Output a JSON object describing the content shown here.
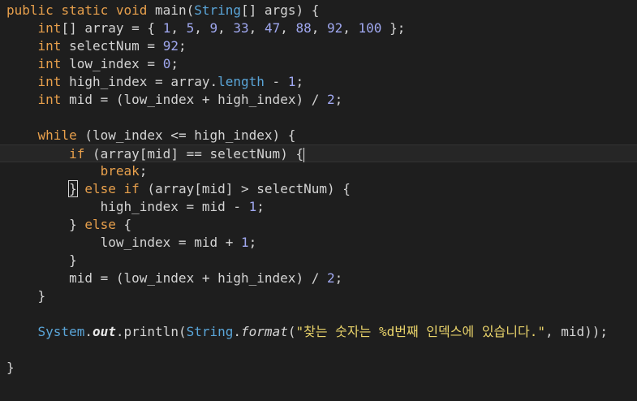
{
  "lines": [
    {
      "indent": "",
      "tokens": [
        {
          "t": "kw",
          "v": "public"
        },
        {
          "t": "p",
          "v": " "
        },
        {
          "t": "kw",
          "v": "static"
        },
        {
          "t": "p",
          "v": " "
        },
        {
          "t": "kw",
          "v": "void"
        },
        {
          "t": "p",
          "v": " "
        },
        {
          "t": "fn",
          "v": "main"
        },
        {
          "t": "p",
          "v": "("
        },
        {
          "t": "typ",
          "v": "String"
        },
        {
          "t": "p",
          "v": "[] "
        },
        {
          "t": "id",
          "v": "args"
        },
        {
          "t": "p",
          "v": ") {"
        }
      ]
    },
    {
      "indent": "    ",
      "tokens": [
        {
          "t": "type",
          "v": "int"
        },
        {
          "t": "p",
          "v": "[] "
        },
        {
          "t": "id",
          "v": "array"
        },
        {
          "t": "p",
          "v": " = { "
        },
        {
          "t": "num",
          "v": "1"
        },
        {
          "t": "p",
          "v": ", "
        },
        {
          "t": "num",
          "v": "5"
        },
        {
          "t": "p",
          "v": ", "
        },
        {
          "t": "num",
          "v": "9"
        },
        {
          "t": "p",
          "v": ", "
        },
        {
          "t": "num",
          "v": "33"
        },
        {
          "t": "p",
          "v": ", "
        },
        {
          "t": "num",
          "v": "47"
        },
        {
          "t": "p",
          "v": ", "
        },
        {
          "t": "num",
          "v": "88"
        },
        {
          "t": "p",
          "v": ", "
        },
        {
          "t": "num",
          "v": "92"
        },
        {
          "t": "p",
          "v": ", "
        },
        {
          "t": "num",
          "v": "100"
        },
        {
          "t": "p",
          "v": " };"
        }
      ]
    },
    {
      "indent": "    ",
      "tokens": [
        {
          "t": "type",
          "v": "int"
        },
        {
          "t": "p",
          "v": " "
        },
        {
          "t": "id",
          "v": "selectNum"
        },
        {
          "t": "p",
          "v": " = "
        },
        {
          "t": "num",
          "v": "92"
        },
        {
          "t": "p",
          "v": ";"
        }
      ]
    },
    {
      "indent": "    ",
      "tokens": [
        {
          "t": "type",
          "v": "int"
        },
        {
          "t": "p",
          "v": " "
        },
        {
          "t": "id",
          "v": "low_index"
        },
        {
          "t": "p",
          "v": " = "
        },
        {
          "t": "num",
          "v": "0"
        },
        {
          "t": "p",
          "v": ";"
        }
      ]
    },
    {
      "indent": "    ",
      "tokens": [
        {
          "t": "type",
          "v": "int"
        },
        {
          "t": "p",
          "v": " "
        },
        {
          "t": "id",
          "v": "high_index"
        },
        {
          "t": "p",
          "v": " = "
        },
        {
          "t": "id",
          "v": "array"
        },
        {
          "t": "p",
          "v": "."
        },
        {
          "t": "prop",
          "v": "length"
        },
        {
          "t": "p",
          "v": " - "
        },
        {
          "t": "num",
          "v": "1"
        },
        {
          "t": "p",
          "v": ";"
        }
      ]
    },
    {
      "indent": "    ",
      "tokens": [
        {
          "t": "type",
          "v": "int"
        },
        {
          "t": "p",
          "v": " "
        },
        {
          "t": "id",
          "v": "mid"
        },
        {
          "t": "p",
          "v": " = ("
        },
        {
          "t": "id",
          "v": "low_index"
        },
        {
          "t": "p",
          "v": " + "
        },
        {
          "t": "id",
          "v": "high_index"
        },
        {
          "t": "p",
          "v": ") / "
        },
        {
          "t": "num",
          "v": "2"
        },
        {
          "t": "p",
          "v": ";"
        }
      ]
    },
    {
      "indent": "",
      "tokens": []
    },
    {
      "indent": "    ",
      "tokens": [
        {
          "t": "kw",
          "v": "while"
        },
        {
          "t": "p",
          "v": " ("
        },
        {
          "t": "id",
          "v": "low_index"
        },
        {
          "t": "p",
          "v": " <= "
        },
        {
          "t": "id",
          "v": "high_index"
        },
        {
          "t": "p",
          "v": ") {"
        }
      ]
    },
    {
      "indent": "        ",
      "current": true,
      "tokens": [
        {
          "t": "kw",
          "v": "if"
        },
        {
          "t": "p",
          "v": " ("
        },
        {
          "t": "id",
          "v": "array"
        },
        {
          "t": "p",
          "v": "["
        },
        {
          "t": "id",
          "v": "mid"
        },
        {
          "t": "p",
          "v": "] == "
        },
        {
          "t": "id",
          "v": "selectNum"
        },
        {
          "t": "p",
          "v": ") {"
        },
        {
          "t": "caret",
          "v": ""
        }
      ]
    },
    {
      "indent": "            ",
      "tokens": [
        {
          "t": "kw",
          "v": "break"
        },
        {
          "t": "p",
          "v": ";"
        }
      ]
    },
    {
      "indent": "        ",
      "tokens": [
        {
          "t": "box",
          "v": "}"
        },
        {
          "t": "p",
          "v": " "
        },
        {
          "t": "kw",
          "v": "else"
        },
        {
          "t": "p",
          "v": " "
        },
        {
          "t": "kw",
          "v": "if"
        },
        {
          "t": "p",
          "v": " ("
        },
        {
          "t": "id",
          "v": "array"
        },
        {
          "t": "p",
          "v": "["
        },
        {
          "t": "id",
          "v": "mid"
        },
        {
          "t": "p",
          "v": "] > "
        },
        {
          "t": "id",
          "v": "selectNum"
        },
        {
          "t": "p",
          "v": ") {"
        }
      ]
    },
    {
      "indent": "            ",
      "tokens": [
        {
          "t": "id",
          "v": "high_index"
        },
        {
          "t": "p",
          "v": " = "
        },
        {
          "t": "id",
          "v": "mid"
        },
        {
          "t": "p",
          "v": " - "
        },
        {
          "t": "num",
          "v": "1"
        },
        {
          "t": "p",
          "v": ";"
        }
      ]
    },
    {
      "indent": "        ",
      "tokens": [
        {
          "t": "p",
          "v": "} "
        },
        {
          "t": "kw",
          "v": "else"
        },
        {
          "t": "p",
          "v": " {"
        }
      ]
    },
    {
      "indent": "            ",
      "tokens": [
        {
          "t": "id",
          "v": "low_index"
        },
        {
          "t": "p",
          "v": " = "
        },
        {
          "t": "id",
          "v": "mid"
        },
        {
          "t": "p",
          "v": " + "
        },
        {
          "t": "num",
          "v": "1"
        },
        {
          "t": "p",
          "v": ";"
        }
      ]
    },
    {
      "indent": "        ",
      "tokens": [
        {
          "t": "p",
          "v": "}"
        }
      ]
    },
    {
      "indent": "        ",
      "tokens": [
        {
          "t": "id",
          "v": "mid"
        },
        {
          "t": "p",
          "v": " = ("
        },
        {
          "t": "id",
          "v": "low_index"
        },
        {
          "t": "p",
          "v": " + "
        },
        {
          "t": "id",
          "v": "high_index"
        },
        {
          "t": "p",
          "v": ") / "
        },
        {
          "t": "num",
          "v": "2"
        },
        {
          "t": "p",
          "v": ";"
        }
      ]
    },
    {
      "indent": "    ",
      "tokens": [
        {
          "t": "p",
          "v": "}"
        }
      ]
    },
    {
      "indent": "",
      "tokens": []
    },
    {
      "indent": "    ",
      "tokens": [
        {
          "t": "typ",
          "v": "System"
        },
        {
          "t": "p",
          "v": "."
        },
        {
          "t": "fld",
          "v": "out"
        },
        {
          "t": "p",
          "v": "."
        },
        {
          "t": "fn",
          "v": "println"
        },
        {
          "t": "p",
          "v": "("
        },
        {
          "t": "typ",
          "v": "String"
        },
        {
          "t": "p",
          "v": "."
        },
        {
          "t": "ifn",
          "v": "format"
        },
        {
          "t": "p",
          "v": "("
        },
        {
          "t": "str",
          "v": "\"찾는 숫자는 %d번째 인덱스에 있습니다.\""
        },
        {
          "t": "p",
          "v": ", "
        },
        {
          "t": "id",
          "v": "mid"
        },
        {
          "t": "p",
          "v": "));"
        }
      ]
    },
    {
      "indent": "",
      "tokens": []
    },
    {
      "indent": "",
      "tokens": [
        {
          "t": "p",
          "v": "}"
        }
      ]
    }
  ]
}
